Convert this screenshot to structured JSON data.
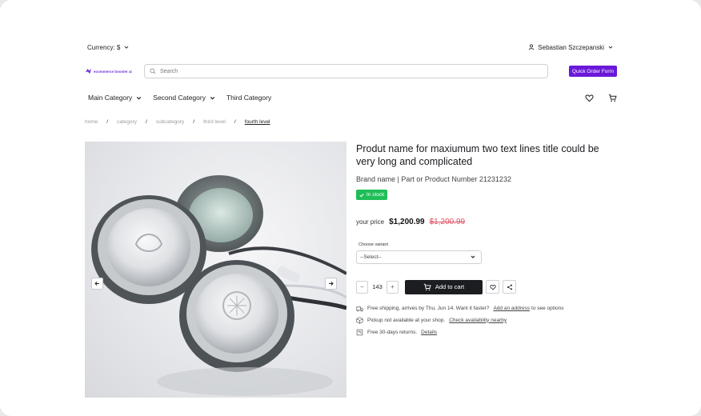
{
  "topbar": {
    "currency": "Currency: $",
    "user": "Sebastian Szczepanski"
  },
  "header": {
    "logo": "ecommerce booster ai",
    "search_placeholder": "Search",
    "quick_order": "Quick Order Form"
  },
  "nav": {
    "categories": [
      "Main Category",
      "Second Category",
      "Third Category"
    ]
  },
  "breadcrumb": [
    "home",
    "category",
    "subcategory",
    "third level",
    "fourth level"
  ],
  "product": {
    "title": "Produt name for maxiumum two text lines title could be very long and complicated",
    "brand_line": "Brand name | Part or Product Number 21231232",
    "stock": "In stock",
    "price_label": "your price",
    "price": "$1,200.99",
    "old_price": "$1,200.99",
    "variant_label": "Choose variant",
    "variant_value": "--Select--",
    "quantity": "143",
    "add_to_cart": "Add to cart",
    "shipping_text": "Free shipping, arrives by Thu, Jun 14. Want it faster?",
    "shipping_link": "Add an address",
    "shipping_tail": "to see options",
    "pickup_text": "Pickup not available at your shop.",
    "pickup_link": "Check availability nearby",
    "returns_text": "Free 30-days returns.",
    "returns_link": "Details"
  },
  "colors": {
    "accent": "#6a18d9",
    "stock": "#1fbe58",
    "old_price": "#e24f63",
    "cart_button": "#1c1d21"
  },
  "icons": [
    "chevron-down-icon",
    "user-icon",
    "search-icon",
    "heart-icon",
    "cart-icon",
    "arrow-left-icon",
    "arrow-right-icon",
    "check-icon",
    "share-icon",
    "truck-icon",
    "box-icon",
    "return-icon"
  ]
}
